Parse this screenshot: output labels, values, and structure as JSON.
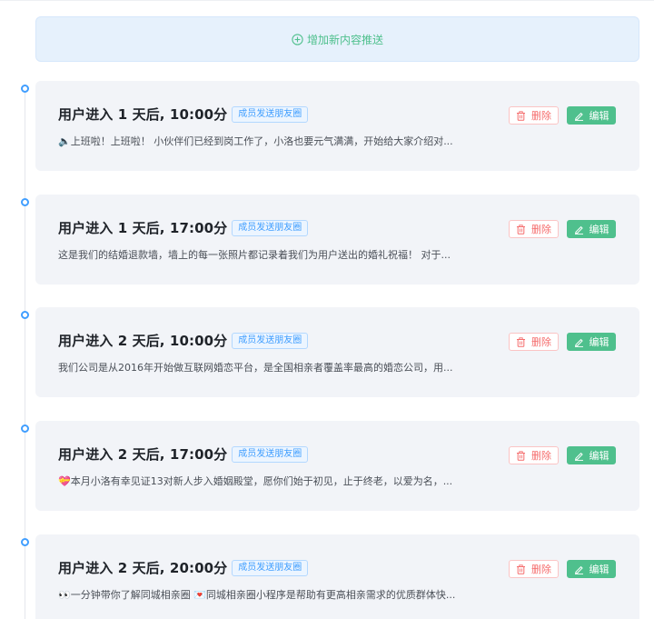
{
  "add_button": {
    "label": "增加新内容推送",
    "icon": "plus-circle-icon"
  },
  "colors": {
    "accent_green": "#4fc08d",
    "tag_blue": "#409eff",
    "danger_red": "#f56c6c",
    "card_bg": "#f2f4f8",
    "add_bar_bg": "#e6f1fc"
  },
  "actions": {
    "delete_label": "删除",
    "edit_label": "编辑",
    "delete_icon": "trash-icon",
    "edit_icon": "pencil-icon"
  },
  "items": [
    {
      "title": "用户进入 1 天后, 10:00分",
      "tag": "成员发送朋友圈",
      "desc": "🔈上班啦！上班啦！ 小伙伴们已经到岗工作了，小洛也要元气满满，开始给大家介绍对..."
    },
    {
      "title": "用户进入 1 天后, 17:00分",
      "tag": "成员发送朋友圈",
      "desc": "这是我们的结婚退款墙，墙上的每一张照片都记录着我们为用户送出的婚礼祝福！ 对于..."
    },
    {
      "title": "用户进入 2 天后, 10:00分",
      "tag": "成员发送朋友圈",
      "desc": "我们公司是从2016年开始做互联网婚恋平台，是全国相亲者覆盖率最高的婚恋公司，用..."
    },
    {
      "title": "用户进入 2 天后, 17:00分",
      "tag": "成员发送朋友圈",
      "desc": "💝本月小洛有幸见证13对新人步入婚姻殿堂，愿你们始于初见，止于终老，以爱为名，..."
    },
    {
      "title": "用户进入 2 天后, 20:00分",
      "tag": "成员发送朋友圈",
      "desc": "👀一分钟带你了解同城相亲圈 💌同城相亲圈小程序是帮助有更高相亲需求的优质群体快..."
    }
  ]
}
